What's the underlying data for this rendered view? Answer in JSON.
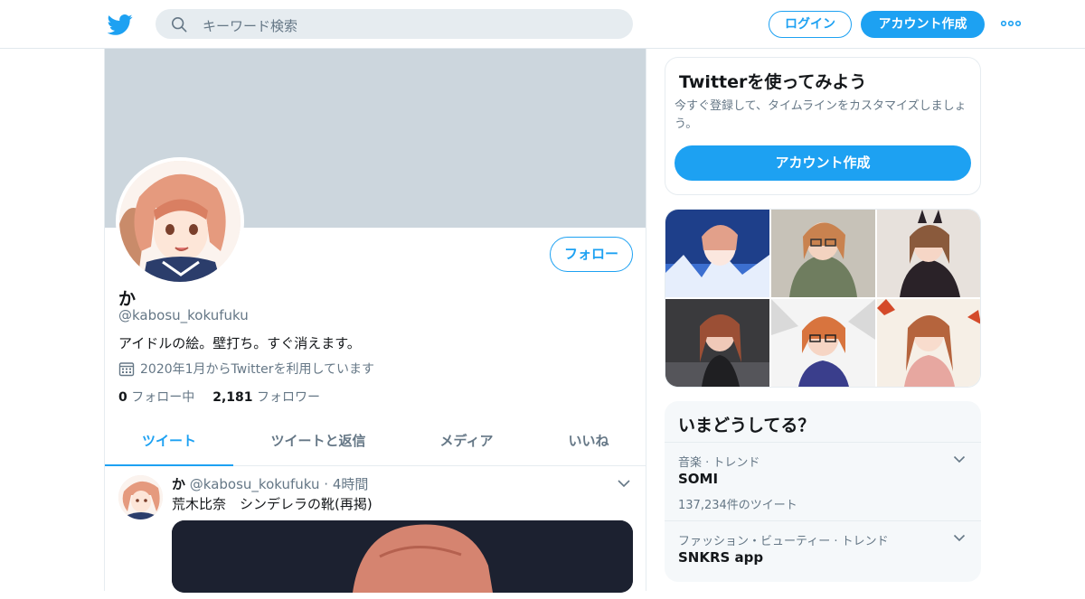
{
  "header": {
    "logo_icon": "twitter-bird-icon",
    "search_placeholder": "キーワード検索",
    "login_label": "ログイン",
    "signup_label": "アカウント作成",
    "more_icon": "more-dots-icon",
    "accent_color": "#1da1f2"
  },
  "profile": {
    "display_name": "か",
    "handle": "@kabosu_kokufuku",
    "bio": "アイドルの絵。壁打ち。すぐ消えます。",
    "joined": "2020年1月からTwitterを利用しています",
    "follow_label": "フォロー",
    "following_count": "0",
    "following_label": "フォロー中",
    "followers_count": "2,181",
    "followers_label": "フォロワー"
  },
  "tabs": [
    {
      "label": "ツイート",
      "active": true
    },
    {
      "label": "ツイートと返信",
      "active": false
    },
    {
      "label": "メディア",
      "active": false
    },
    {
      "label": "いいね",
      "active": false
    }
  ],
  "tweet": {
    "name": "か",
    "handle": "@kabosu_kokufuku",
    "separator": "·",
    "time": "4時間",
    "text": "荒木比奈　シンデレラの靴(再掲)"
  },
  "signup_card": {
    "title": "Twitterを使ってみよう",
    "description": "今すぐ登録して、タイムラインをカスタマイズしましょう。",
    "button_label": "アカウント作成"
  },
  "trends": {
    "title": "いまどうしてる？",
    "items": [
      {
        "category": "音楽 · トレンド",
        "name": "SOMI",
        "count": "137,234件のツイート"
      },
      {
        "category": "ファッション・ビューティー · トレンド",
        "name": "SNKRS app",
        "count": ""
      }
    ]
  }
}
